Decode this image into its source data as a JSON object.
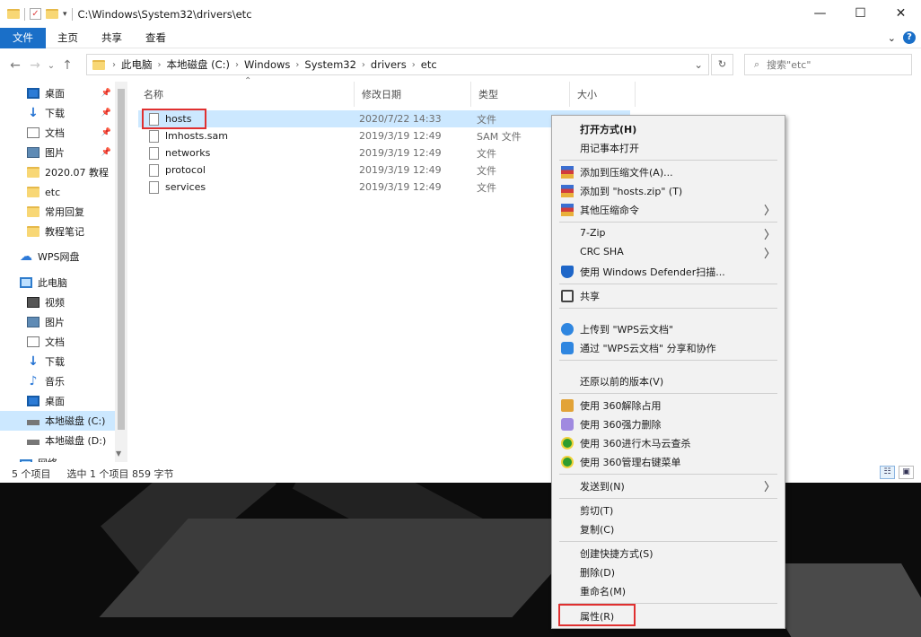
{
  "titlebar": {
    "path": "C:\\Windows\\System32\\drivers\\etc",
    "minimize": "—",
    "maximize": "☐",
    "close": "✕"
  },
  "ribbon": {
    "tabs": [
      "文件",
      "主页",
      "共享",
      "查看"
    ],
    "expand": "⌄",
    "help": "?"
  },
  "nav": {
    "back": "←",
    "forward": "→",
    "recent": "⌄",
    "up": "↑",
    "breadcrumb": [
      "此电脑",
      "本地磁盘 (C:)",
      "Windows",
      "System32",
      "drivers",
      "etc"
    ],
    "refresh": "↻",
    "search_placeholder": "搜索\"etc\"",
    "search_icon": "⌕"
  },
  "sidebar": {
    "quick_access": [
      {
        "label": "桌面",
        "icon": "desktop-icon"
      },
      {
        "label": "下载",
        "icon": "download-icon"
      },
      {
        "label": "文档",
        "icon": "document-icon"
      },
      {
        "label": "图片",
        "icon": "pictures-icon"
      },
      {
        "label": "2020.07 教程",
        "icon": "folder-icon"
      },
      {
        "label": "etc",
        "icon": "folder-icon"
      },
      {
        "label": "常用回复",
        "icon": "folder-icon"
      },
      {
        "label": "教程笔记",
        "icon": "folder-icon"
      }
    ],
    "wps": "WPS网盘",
    "this_pc": "此电脑",
    "pc_items": [
      {
        "label": "视频",
        "icon": "video-icon"
      },
      {
        "label": "图片",
        "icon": "pictures-icon"
      },
      {
        "label": "文档",
        "icon": "document-icon"
      },
      {
        "label": "下载",
        "icon": "download-icon"
      },
      {
        "label": "音乐",
        "icon": "music-icon"
      },
      {
        "label": "桌面",
        "icon": "desktop-icon"
      },
      {
        "label": "本地磁盘 (C:)",
        "icon": "drive-icon"
      },
      {
        "label": "本地磁盘 (D:)",
        "icon": "drive-icon"
      },
      {
        "label": "网络",
        "icon": "network-icon"
      }
    ]
  },
  "columns": {
    "name": "名称",
    "modified": "修改日期",
    "type": "类型",
    "size": "大小"
  },
  "files": [
    {
      "name": "hosts",
      "modified": "2020/7/22 14:33",
      "type": "文件"
    },
    {
      "name": "lmhosts.sam",
      "modified": "2019/3/19 12:49",
      "type": "SAM 文件"
    },
    {
      "name": "networks",
      "modified": "2019/3/19 12:49",
      "type": "文件"
    },
    {
      "name": "protocol",
      "modified": "2019/3/19 12:49",
      "type": "文件"
    },
    {
      "name": "services",
      "modified": "2019/3/19 12:49",
      "type": "文件"
    }
  ],
  "status": {
    "count": "5 个项目",
    "selected": "选中 1 个项目  859 字节"
  },
  "context_menu": {
    "open_with": "打开方式(H)",
    "notepad": "用记事本打开",
    "add_archive": "添加到压缩文件(A)...",
    "add_zip": "添加到 \"hosts.zip\" (T)",
    "other_compress": "其他压缩命令",
    "sevenzip": "7-Zip",
    "crc": "CRC SHA",
    "defender": "使用 Windows Defender扫描...",
    "share": "共享",
    "upload_wps": "上传到 \"WPS云文档\"",
    "share_wps": "通过 \"WPS云文档\" 分享和协作",
    "restore": "还原以前的版本(V)",
    "unlock360": "使用 360解除占用",
    "delete360": "使用 360强力删除",
    "scan360": "使用 360进行木马云查杀",
    "manage360": "使用 360管理右键菜单",
    "send_to": "发送到(N)",
    "cut": "剪切(T)",
    "copy": "复制(C)",
    "shortcut": "创建快捷方式(S)",
    "delete": "删除(D)",
    "rename": "重命名(M)",
    "properties": "属性(R)",
    "submenu_arrow": "〉"
  }
}
